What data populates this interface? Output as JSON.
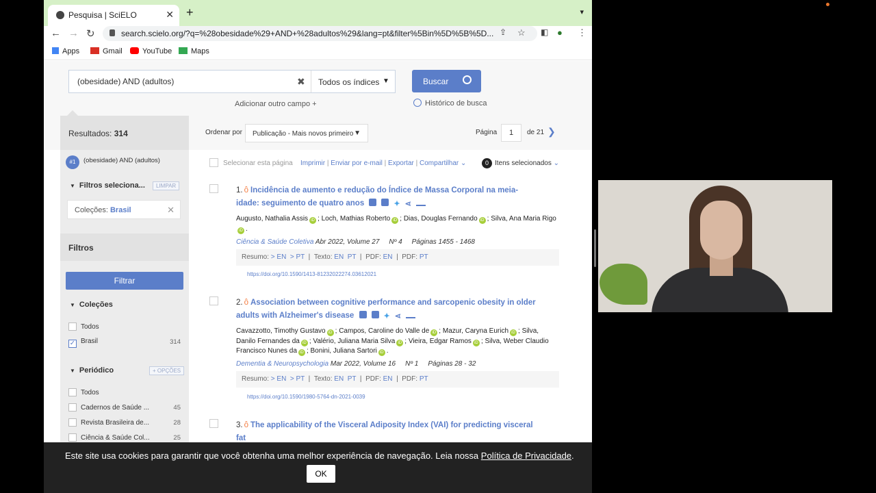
{
  "browser": {
    "tab_title": "Pesquisa | SciELO",
    "url": "search.scielo.org/?q=%28obesidade%29+AND+%28adultos%29&lang=pt&filter%5Bin%5D%5B%5D...",
    "bookmarks": [
      "Apps",
      "Gmail",
      "YouTube",
      "Maps"
    ]
  },
  "search": {
    "query": "(obesidade) AND (adultos)",
    "index": "Todos os índices",
    "button": "Buscar",
    "add_field": "Adicionar outro campo +",
    "history": "Histórico de busca"
  },
  "sidebar": {
    "results_label": "Resultados:",
    "results_count": "314",
    "query_num": "#1",
    "query_text": "(obesidade) AND (adultos)",
    "selected_filters": "Filtros seleciona...",
    "clear": "LIMPAR",
    "colecoes_label": "Coleções:",
    "colecoes_value": "Brasil",
    "filters": "Filtros",
    "filter_btn": "Filtrar",
    "colecoes": "Coleções",
    "colecoes_items": [
      {
        "label": "Todos",
        "count": ""
      },
      {
        "label": "Brasil",
        "count": "314"
      }
    ],
    "periodico": "Periódico",
    "options": "+ OPÇÕES",
    "periodico_items": [
      {
        "label": "Todos",
        "count": ""
      },
      {
        "label": "Cadernos de Saúde ...",
        "count": "45"
      },
      {
        "label": "Revista Brasileira de...",
        "count": "28"
      },
      {
        "label": "Ciência & Saúde Col...",
        "count": "25"
      }
    ]
  },
  "results_bar": {
    "order_label": "Ordenar por",
    "order_value": "Publicação - Mais novos primeiro",
    "page_label": "Página",
    "page": "1",
    "page_of": "de 21"
  },
  "toolbar": {
    "select_page": "Selecionar esta página",
    "imprimir": "Imprimir",
    "email": "Enviar por e-mail",
    "exportar": "Exportar",
    "compartilhar": "Compartilhar",
    "selected_count": "0",
    "selected_label": "Itens selecionados"
  },
  "articles": [
    {
      "num": "1.",
      "title": "Incidência de aumento e redução do Índice de Massa Corporal na meia-idade: seguimento de quatro anos",
      "authors": [
        "Augusto, Nathalia Assis",
        "Loch, Mathias Roberto",
        "Dias, Douglas Fernando",
        "Silva, Ana Maria Rigo"
      ],
      "journal": "Ciência & Saúde Coletiva",
      "date": "Abr 2022, Volume 27",
      "number": "Nº 4",
      "pages": "Páginas 1455 - 1468",
      "resumo": "Resumo:",
      "doi": "https://doi.org/10.1590/1413-81232022274.03612021"
    },
    {
      "num": "2.",
      "title": "Association between cognitive performance and sarcopenic obesity in older adults with Alzheimer's disease",
      "authors": [
        "Cavazzotto, Timothy Gustavo",
        "Campos, Caroline do Valle de",
        "Mazur, Caryna Eurich",
        "Silva, Danilo Fernandes da",
        "Valério, Juliana Maria Silva",
        "Vieira, Edgar Ramos",
        "Silva, Weber Claudio Francisco Nunes da",
        "Bonini, Juliana Sartori"
      ],
      "journal": "Dementia & Neuropsychologia",
      "date": "Mar 2022, Volume 16",
      "number": "Nº 1",
      "pages": "Páginas 28 - 32",
      "resumo": "Resumo:",
      "doi": "https://doi.org/10.1590/1980-5764-dn-2021-0039"
    },
    {
      "num": "3.",
      "title": "The applicability of the Visceral Adiposity Index (VAI) for predicting visceral fat"
    }
  ],
  "link_labels": {
    "en": "EN",
    "pt": "PT",
    "gt_en": "> EN",
    "gt_pt": "> PT",
    "texto": "Texto:",
    "pdf": "PDF:"
  },
  "cookie": {
    "message": "Este site usa cookies para garantir que você obtenha uma melhor experiência de navegação. Leia nossa",
    "link": "Política de Privacidade",
    "ok": "OK"
  }
}
